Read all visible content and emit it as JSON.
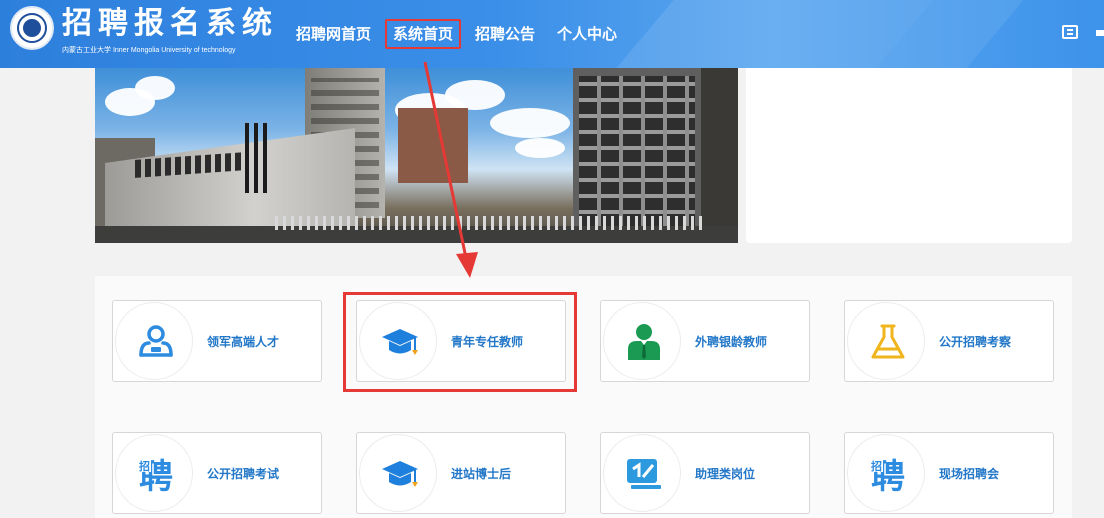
{
  "header": {
    "title": "招聘报名系统",
    "subtitle": "内蒙古工业大学 Inner Mongolia University of technology",
    "nav": [
      {
        "label": "招聘网首页",
        "active": false
      },
      {
        "label": "系统首页",
        "active": true
      },
      {
        "label": "招聘公告",
        "active": false
      },
      {
        "label": "个人中心",
        "active": false
      }
    ],
    "accent_color": "#2d7fdc",
    "login_icon": "login-icon"
  },
  "annotation_color": "#e53935",
  "cards": [
    {
      "label": "领军高端人才",
      "icon": "leader-person-icon",
      "highlighted": false
    },
    {
      "label": "青年专任教师",
      "icon": "graduation-cap-icon",
      "highlighted": true
    },
    {
      "label": "外聘银龄教师",
      "icon": "person-suit-icon",
      "highlighted": false
    },
    {
      "label": "公开招聘考察",
      "icon": "flask-icon",
      "highlighted": false
    },
    {
      "label": "公开招聘考试",
      "icon": "recruit-exam-icon",
      "highlighted": false
    },
    {
      "label": "进站博士后",
      "icon": "graduation-cap-icon",
      "highlighted": false
    },
    {
      "label": "助理类岗位",
      "icon": "assistant-post-icon",
      "highlighted": false
    },
    {
      "label": "现场招聘会",
      "icon": "onsite-recruit-icon",
      "highlighted": false
    }
  ],
  "icon_glyphs": {
    "recruit": "聘",
    "recruit_small": "招"
  }
}
